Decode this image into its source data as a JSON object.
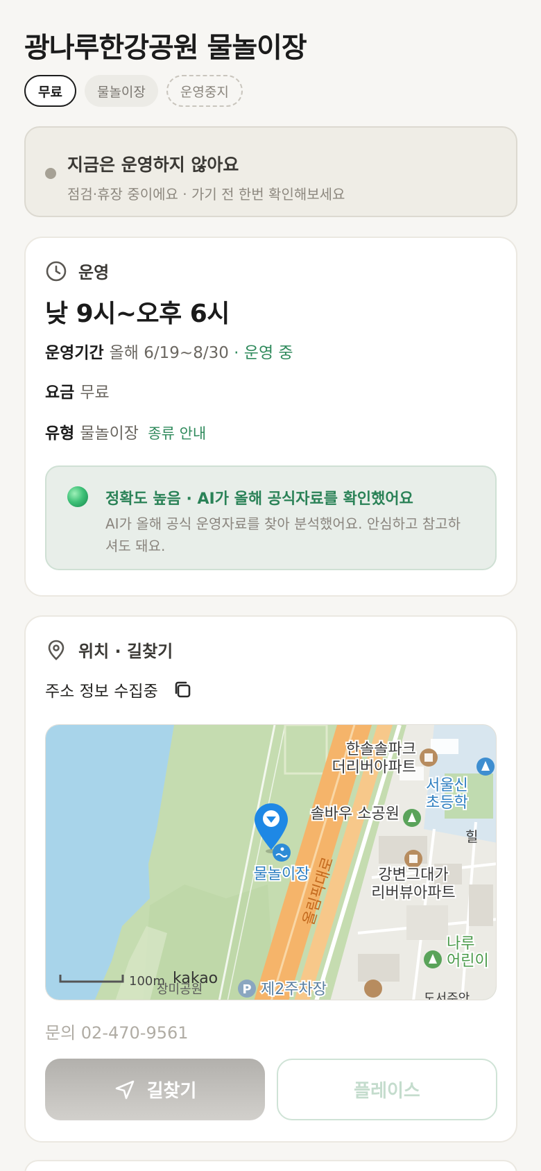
{
  "place": {
    "title": "광나루한강공원 물놀이장",
    "chips": {
      "free": "무료",
      "type": "물놀이장",
      "status": "운영중지"
    }
  },
  "status": {
    "title": "지금은 운영하지 않아요",
    "subtitle": "점검·휴장 중이에요 · 가기 전 한번 확인해보세요"
  },
  "hours": {
    "section_label": "운영",
    "time": "낮 9시~오후 6시",
    "period_label": "운영기간",
    "period_value": "올해 6/19~8/30",
    "period_status": "· 운영 중",
    "fee_label": "요금",
    "fee_value": "무료",
    "type_label": "유형",
    "type_value": "물놀이장",
    "type_link": "종류 안내",
    "ai": {
      "title": "정확도 높음 · AI가 올해 공식자료를 확인했어요",
      "body": "AI가 올해 공식 운영자료를 찾아 분석했어요. 안심하고 참고하셔도 돼요."
    }
  },
  "location": {
    "section_label": "위치 · 길찾기",
    "address": "주소 정보 수집중",
    "map": {
      "labels": {
        "apt1_line1": "한솔솔파크",
        "apt1_line2": "더리버아파트",
        "school_line1": "서울신",
        "school_line2": "초등학",
        "park": "솔바우 소공원",
        "pin": "물놀이장",
        "apt2_line1": "강변그대가",
        "apt2_line2": "리버뷰아파트",
        "road": "올림픽대로",
        "kid_line1": "나루",
        "kid_line2": "어린이",
        "parking": "제2주차장",
        "scale": "100m",
        "brand": "kakao",
        "park2": "장미공원",
        "edge": "도서주안",
        "edge2": "힐"
      }
    },
    "inquiry": "문의 02-470-9561",
    "directions_label": "길찾기",
    "place_label": "플레이스"
  },
  "colors": {
    "accent_green": "#2f8a5c",
    "map_water": "#a8d4ea",
    "map_park": "#c5dcb0",
    "map_road": "#f5b46a",
    "pin_blue": "#1e88e5"
  },
  "icons": [
    "clock-icon",
    "location-pin-icon",
    "copy-icon",
    "navigation-arrow-icon",
    "map-pin-icon",
    "swim-icon",
    "tree-icon",
    "building-icon",
    "school-icon",
    "parking-icon"
  ]
}
